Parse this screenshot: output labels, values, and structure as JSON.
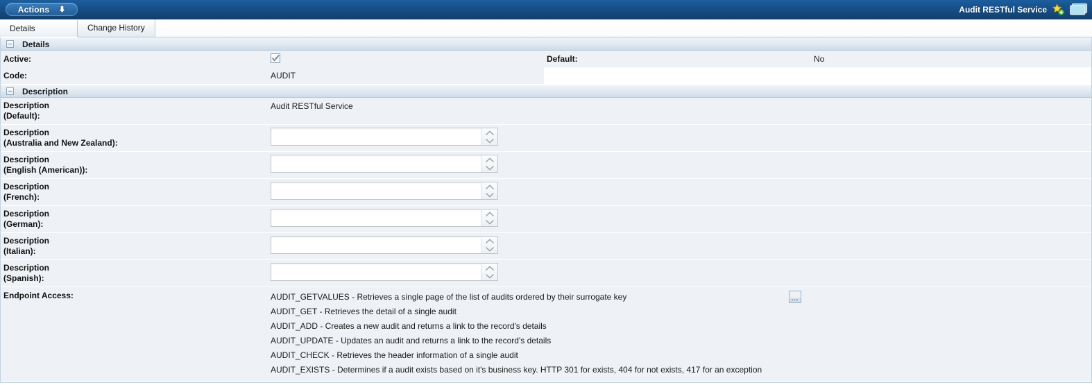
{
  "topbar": {
    "actions_label": "Actions",
    "actions_icon": "arrow-down-icon",
    "title": "Audit RESTful Service",
    "star_icon": "star-add-icon",
    "window_icon": "window-icon",
    "bar_color": "#174f88",
    "button_color": "#2d6daa"
  },
  "tabs": [
    {
      "label": "Details",
      "active": true
    },
    {
      "label": "Change History",
      "active": false
    }
  ],
  "sections": {
    "details": {
      "title": "Details",
      "collapse_icon": "minus-icon",
      "fields": {
        "active_label": "Active:",
        "active_checked": true,
        "active_check_icon": "check-icon",
        "default_label": "Default:",
        "default_value": "No",
        "code_label": "Code:",
        "code_value": "AUDIT"
      }
    },
    "description": {
      "title": "Description",
      "collapse_icon": "minus-icon",
      "rows": [
        {
          "label_line1": "Description",
          "label_line2": "(Default):",
          "type": "text",
          "value": "Audit RESTful Service"
        },
        {
          "label_line1": "Description",
          "label_line2": "(Australia and New Zealand):",
          "type": "textarea",
          "value": "",
          "placeholder": ""
        },
        {
          "label_line1": "Description",
          "label_line2": "(English (American)):",
          "type": "textarea",
          "value": "",
          "placeholder": ""
        },
        {
          "label_line1": "Description",
          "label_line2": "(French):",
          "type": "textarea",
          "value": "",
          "placeholder": ""
        },
        {
          "label_line1": "Description",
          "label_line2": "(German):",
          "type": "textarea",
          "value": "",
          "placeholder": ""
        },
        {
          "label_line1": "Description",
          "label_line2": "(Italian):",
          "type": "textarea",
          "value": "",
          "placeholder": ""
        },
        {
          "label_line1": "Description",
          "label_line2": "(Spanish):",
          "type": "textarea",
          "value": "",
          "placeholder": ""
        }
      ],
      "endpoint": {
        "label": "Endpoint Access:",
        "lookup_button_label": "...",
        "lookup_icon": "ellipsis-icon",
        "lines": [
          "AUDIT_GETVALUES - Retrieves a single page of the list of audits ordered by their surrogate key",
          "AUDIT_GET - Retrieves the detail of a single audit",
          "AUDIT_ADD - Creates a new audit and returns a link to the record's details",
          "AUDIT_UPDATE - Updates an audit and returns a link to the record's details",
          "AUDIT_CHECK - Retrieves the header information of a single audit",
          "AUDIT_EXISTS - Determines if a audit exists based on it's business key. HTTP 301 for exists, 404 for not exists, 417 for an exception"
        ]
      }
    }
  }
}
